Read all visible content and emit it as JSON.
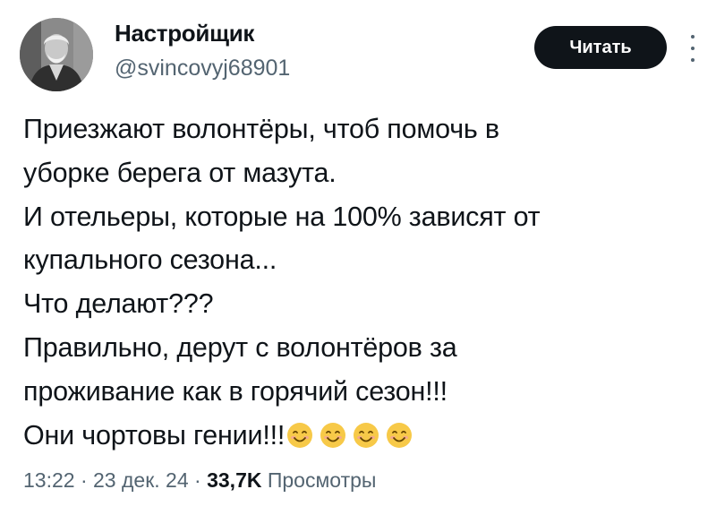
{
  "author": {
    "display_name": "Настройщик",
    "handle": "@svincovyj68901"
  },
  "follow_button": {
    "label": "Читать"
  },
  "more_menu": {
    "icon": "more-vertical-icon"
  },
  "tweet": {
    "lines": [
      "Приезжают волонтёры, чтоб помочь в",
      "уборке берега от мазута.",
      "И отельеры, которые на 100% зависят от",
      "купального сезона...",
      "Что делают???",
      "Правильно, дерут с волонтёров за",
      "проживание как в горячий сезон!!!",
      "Они чортовы гении!!!"
    ],
    "emoji": [
      "😊",
      "😊",
      "😊",
      "😊"
    ]
  },
  "meta": {
    "time": "13:22",
    "separator_1": " · ",
    "date": "23 дек. 24",
    "separator_2": " · ",
    "views_count": "33,7K",
    "views_label": " Просмотры"
  },
  "colors": {
    "text_primary": "#0f1419",
    "text_secondary": "#536471",
    "button_bg": "#0f1419",
    "button_text": "#ffffff",
    "emoji_face": "#f7c948"
  }
}
